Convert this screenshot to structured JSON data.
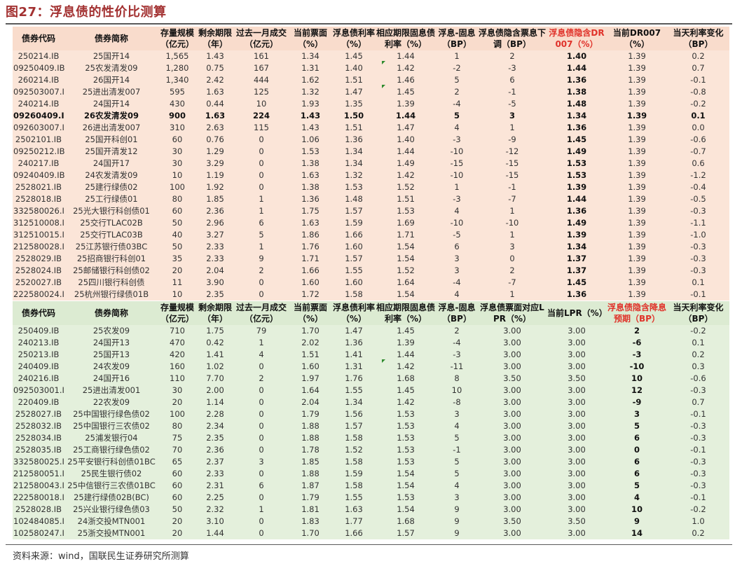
{
  "title": "图27：浮息债的性价比测算",
  "source": "资料来源：wind，国联民生证券研究所测算",
  "colors": {
    "title": "#a33232",
    "top_bg": "#fbe5d8",
    "bottom_bg": "#e4f0dc",
    "highlight_header": "#e0322a"
  },
  "top_table": {
    "headers": [
      "债券代码",
      "债券简称",
      "存量规模（亿元）",
      "剩余期限（年）",
      "过去一月成交（亿元）",
      "当前票面（%）",
      "浮息债利率（%）",
      "相应期限固息债利率（%）",
      "浮息-固息（BP）",
      "浮息债隐含票息下调（BP）",
      "浮息债隐含DR007（%）",
      "当前DR007（%）",
      "当天利率变化（BP）"
    ],
    "rows": [
      [
        "250214.IB",
        "25国开14",
        "1,565",
        "1.43",
        "161",
        "1.34",
        "1.45",
        "1.44",
        "1",
        "2",
        "1.40",
        "1.39",
        "0.2"
      ],
      [
        "09250409.IB",
        "25农发清发09",
        "1,280",
        "0.75",
        "167",
        "1.31",
        "1.40",
        "1.42",
        "-2",
        "-3",
        "1.44",
        "1.39",
        "0.7"
      ],
      [
        "260214.IB",
        "26国开14",
        "1,340",
        "2.42",
        "444",
        "1.62",
        "1.51",
        "1.46",
        "5",
        "6",
        "1.36",
        "1.39",
        "-0.1"
      ],
      [
        "092503007.IB",
        "25进出清发007",
        "595",
        "1.63",
        "125",
        "1.32",
        "1.47",
        "1.45",
        "2",
        "-1",
        "1.38",
        "1.39",
        "-0.8"
      ],
      [
        "240214.IB",
        "24国开14",
        "430",
        "0.44",
        "10",
        "1.93",
        "1.35",
        "1.39",
        "-4",
        "-5",
        "1.48",
        "1.39",
        "-0.2"
      ],
      [
        "09260409.IB",
        "26农发清发09",
        "900",
        "1.63",
        "224",
        "1.43",
        "1.50",
        "1.44",
        "5",
        "3",
        "1.34",
        "1.39",
        "0.1"
      ],
      [
        "092603007.IB",
        "26进出清发007",
        "310",
        "2.63",
        "115",
        "1.43",
        "1.51",
        "1.47",
        "4",
        "1",
        "1.36",
        "1.39",
        "0.0"
      ],
      [
        "2502101.IB",
        "25国开科创01",
        "60",
        "0.76",
        "0",
        "1.06",
        "1.36",
        "1.40",
        "-3",
        "-9",
        "1.45",
        "1.39",
        "-0.6"
      ],
      [
        "09250212.IB",
        "25国开清发12",
        "30",
        "1.29",
        "0",
        "1.53",
        "1.34",
        "1.44",
        "-10",
        "-12",
        "1.49",
        "1.39",
        "-0.7"
      ],
      [
        "240217.IB",
        "24国开17",
        "30",
        "3.29",
        "0",
        "1.38",
        "1.34",
        "1.49",
        "-15",
        "-15",
        "1.53",
        "1.39",
        "0.6"
      ],
      [
        "09240409.IB",
        "24农发清发09",
        "10",
        "1.19",
        "0",
        "1.63",
        "1.32",
        "1.42",
        "-10",
        "-15",
        "1.53",
        "1.39",
        "-1.2"
      ],
      [
        "2528021.IB",
        "25建行绿债02",
        "100",
        "1.92",
        "0",
        "1.38",
        "1.53",
        "1.52",
        "1",
        "-1",
        "1.39",
        "1.39",
        "-0.4"
      ],
      [
        "2528018.IB",
        "25工行绿债01",
        "80",
        "1.85",
        "1",
        "1.36",
        "1.48",
        "1.51",
        "-3",
        "-7",
        "1.44",
        "1.39",
        "-0.5"
      ],
      [
        "332580026.IB",
        "25光大银行科创债01",
        "60",
        "2.36",
        "1",
        "1.75",
        "1.57",
        "1.53",
        "4",
        "1",
        "1.36",
        "1.39",
        "-0.3"
      ],
      [
        "312510008.IB",
        "25交行TLAC02B",
        "50",
        "2.96",
        "6",
        "1.63",
        "1.59",
        "1.69",
        "-10",
        "-10",
        "1.49",
        "1.39",
        "-1.1"
      ],
      [
        "312510015.IB",
        "25交行TLAC03B",
        "40",
        "3.27",
        "5",
        "1.86",
        "1.66",
        "1.71",
        "-5",
        "1",
        "1.39",
        "1.39",
        "-1.0"
      ],
      [
        "212580028.IB",
        "25江苏银行债03BC",
        "50",
        "2.33",
        "1",
        "1.76",
        "1.60",
        "1.54",
        "6",
        "3",
        "1.34",
        "1.39",
        "-0.3"
      ],
      [
        "2528029.IB",
        "25招商银行科创01",
        "35",
        "2.33",
        "9",
        "1.71",
        "1.57",
        "1.54",
        "3",
        "0",
        "1.37",
        "1.39",
        "-0.3"
      ],
      [
        "2528024.IB",
        "25邮储银行科创债02",
        "20",
        "2.04",
        "2",
        "1.66",
        "1.55",
        "1.52",
        "3",
        "2",
        "1.37",
        "1.39",
        "-0.3"
      ],
      [
        "2520027.IB",
        "25四川银行科创债",
        "11",
        "3.90",
        "0",
        "1.60",
        "1.60",
        "1.64",
        "-4",
        "-7",
        "1.45",
        "1.39",
        "0.1"
      ],
      [
        "222580024.IB",
        "25杭州银行绿债01B",
        "10",
        "2.35",
        "0",
        "1.72",
        "1.58",
        "1.54",
        "4",
        "1",
        "1.36",
        "1.39",
        "-0.1"
      ]
    ]
  },
  "bottom_table": {
    "headers": [
      "债券代码",
      "债券简称",
      "存量规模（亿元）",
      "剩余期限（年）",
      "过去一月成交（亿元）",
      "当前票面（%）",
      "浮息债利率（%）",
      "相应期限固息债利率（%）",
      "浮息-固息（BP）",
      "浮息债票面对应LPR（%）",
      "当前LPR（%）",
      "浮息债隐含降息预期（BP）",
      "当天利率变化（BP）"
    ],
    "rows": [
      [
        "250409.IB",
        "25农发09",
        "710",
        "1.75",
        "79",
        "1.70",
        "1.47",
        "1.45",
        "2",
        "3.00",
        "3.00",
        "2",
        "-0.2"
      ],
      [
        "240213.IB",
        "24国开13",
        "470",
        "0.42",
        "1",
        "2.02",
        "1.36",
        "1.39",
        "-4",
        "3.00",
        "3.00",
        "-6",
        "0.1"
      ],
      [
        "250213.IB",
        "25国开13",
        "420",
        "1.41",
        "4",
        "1.51",
        "1.41",
        "1.44",
        "-3",
        "3.00",
        "3.00",
        "-3",
        "0.2"
      ],
      [
        "240409.IB",
        "24农发09",
        "160",
        "1.02",
        "0",
        "1.60",
        "1.31",
        "1.42",
        "-11",
        "3.00",
        "3.00",
        "-10",
        "0.3"
      ],
      [
        "240216.IB",
        "24国开16",
        "110",
        "7.70",
        "2",
        "1.97",
        "1.76",
        "1.68",
        "8",
        "3.50",
        "3.50",
        "10",
        "-0.6"
      ],
      [
        "092503001.IB",
        "25进出清发001",
        "30",
        "2.00",
        "0",
        "1.64",
        "1.55",
        "1.45",
        "10",
        "3.00",
        "3.00",
        "12",
        "-0.3"
      ],
      [
        "220409.IB",
        "22农发09",
        "20",
        "1.14",
        "0",
        "2.04",
        "1.34",
        "1.42",
        "-8",
        "3.00",
        "3.00",
        "-9",
        "0.7"
      ],
      [
        "2528027.IB",
        "25中国银行绿色债02",
        "100",
        "2.28",
        "0",
        "1.79",
        "1.56",
        "1.53",
        "3",
        "3.00",
        "3.00",
        "3",
        "-0.1"
      ],
      [
        "2528032.IB",
        "25中国银行三农债02",
        "80",
        "2.34",
        "0",
        "1.88",
        "1.57",
        "1.53",
        "4",
        "3.00",
        "3.00",
        "5",
        "-0.3"
      ],
      [
        "2528034.IB",
        "25浦发银行04",
        "75",
        "2.35",
        "0",
        "1.88",
        "1.58",
        "1.53",
        "5",
        "3.00",
        "3.00",
        "6",
        "-0.3"
      ],
      [
        "2528035.IB",
        "25工商银行绿色债02",
        "70",
        "2.36",
        "0",
        "1.78",
        "1.52",
        "1.53",
        "-1",
        "3.00",
        "3.00",
        "0",
        "-0.1"
      ],
      [
        "332580025.IB",
        "25平安银行科创债01BC",
        "65",
        "2.37",
        "3",
        "1.85",
        "1.58",
        "1.53",
        "5",
        "3.00",
        "3.00",
        "6",
        "-0.3"
      ],
      [
        "212580051.IB",
        "25民生银行债02",
        "60",
        "2.33",
        "0",
        "1.88",
        "1.59",
        "1.54",
        "5",
        "3.00",
        "3.00",
        "6",
        "-0.3"
      ],
      [
        "212580043.IB",
        "25中信银行三农债01BC",
        "60",
        "2.31",
        "6",
        "1.87",
        "1.58",
        "1.54",
        "4",
        "3.00",
        "3.00",
        "5",
        "-0.3"
      ],
      [
        "222580018.IB",
        "25建行绿债02B(BC)",
        "60",
        "2.25",
        "0",
        "1.79",
        "1.55",
        "1.53",
        "3",
        "3.00",
        "3.00",
        "4",
        "-0.1"
      ],
      [
        "2528028.IB",
        "25兴业银行绿色债03",
        "50",
        "2.32",
        "1",
        "1.81",
        "1.63",
        "1.54",
        "9",
        "3.00",
        "3.00",
        "10",
        "-0.2"
      ],
      [
        "102484085.IB",
        "24浙交投MTN001",
        "20",
        "3.10",
        "0",
        "1.83",
        "1.77",
        "1.68",
        "9",
        "3.50",
        "3.50",
        "9",
        "1.0"
      ],
      [
        "102580247.IB",
        "25浙交投MTN001",
        "20",
        "1.44",
        "0",
        "1.70",
        "1.66",
        "1.57",
        "9",
        "3.00",
        "3.00",
        "14",
        "0.2"
      ]
    ]
  }
}
